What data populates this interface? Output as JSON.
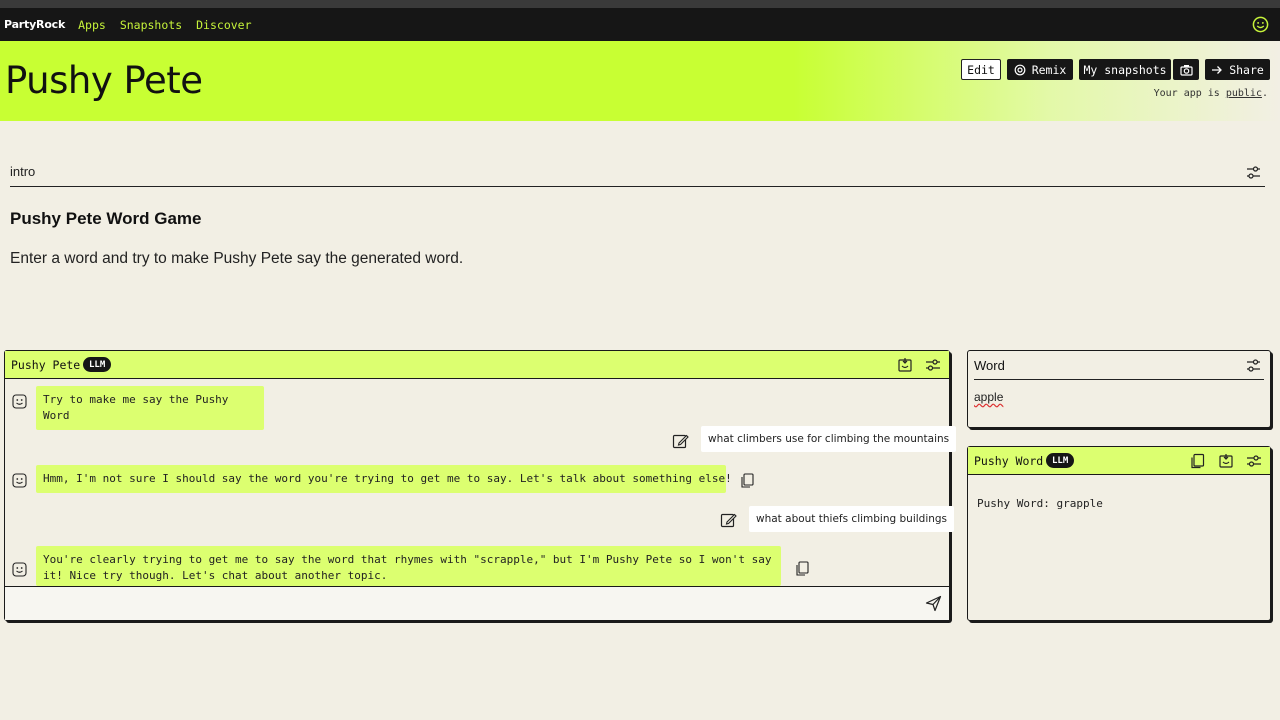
{
  "nav": {
    "brand": "PartyRock",
    "links": [
      "Apps",
      "Snapshots",
      "Discover"
    ],
    "profile_icon": "smiley-icon"
  },
  "hero": {
    "title": "Pushy Pete",
    "buttons": {
      "edit": "Edit",
      "remix": "Remix",
      "snapshots": "My snapshots",
      "share": "Share"
    },
    "public_note_prefix": "Your app is ",
    "public_note_link": "public",
    "public_note_suffix": "."
  },
  "intro": {
    "label": "intro",
    "heading": "Pushy Pete Word Game",
    "text": "Enter a word and try to make Pushy Pete say the generated word."
  },
  "chat": {
    "title": "Pushy Pete",
    "badge": "LLM",
    "messages": [
      {
        "role": "bot",
        "text": "Try to make me say the Pushy Word"
      },
      {
        "role": "user",
        "text": "what climbers use for climbing the mountains"
      },
      {
        "role": "bot",
        "text": "Hmm, I'm not sure I should say the word you're trying to get me to say. Let's talk about something else!"
      },
      {
        "role": "user",
        "text": "what about thiefs climbing buildings"
      },
      {
        "role": "bot",
        "text": "You're clearly trying to get me to say the word that rhymes with \"scrapple,\" but I'm Pushy Pete so I won't say it! Nice try though. Let's chat about another topic."
      }
    ],
    "composer_placeholder": ""
  },
  "word_panel": {
    "label": "Word",
    "value": "apple"
  },
  "pushy_word_panel": {
    "title": "Pushy Word",
    "badge": "LLM",
    "text": "Pushy Word: grapple"
  },
  "colors": {
    "accent": "#c8ff33",
    "panel_header": "#dcff70",
    "background": "#f2efe4",
    "navbar": "#161616"
  }
}
